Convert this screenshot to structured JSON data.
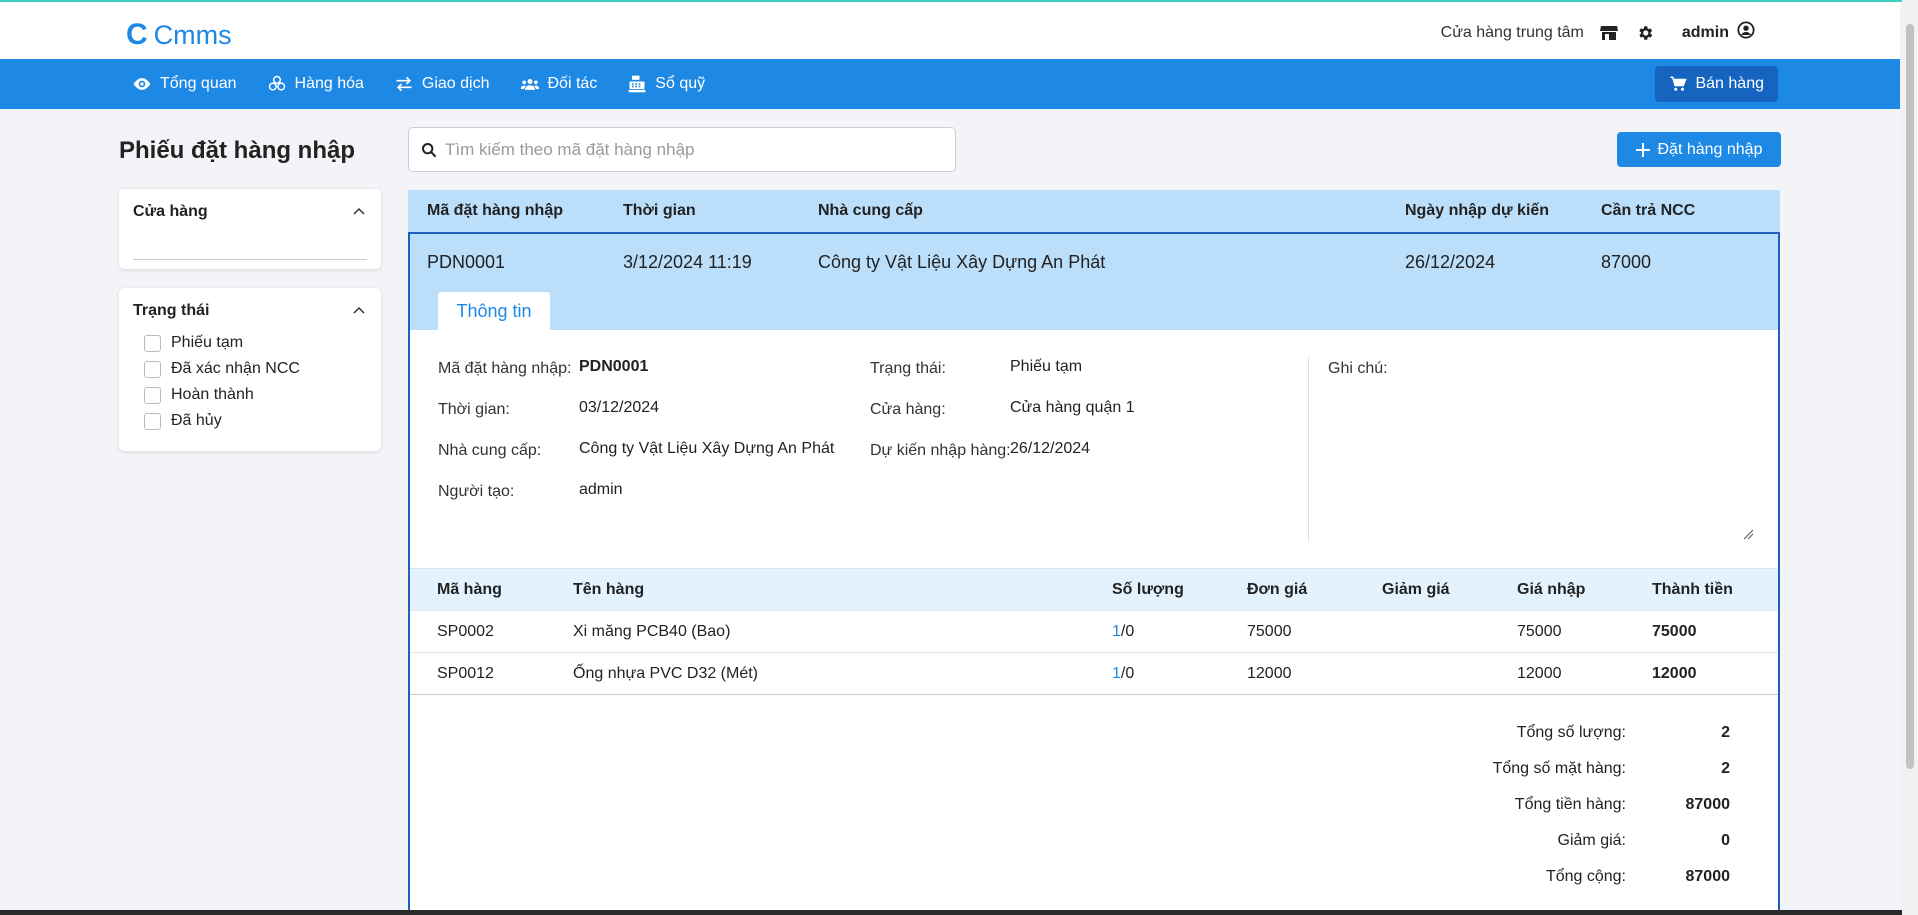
{
  "app": {
    "logo_text": "Cmms"
  },
  "header": {
    "store": "Cửa hàng trung tâm",
    "user": "admin"
  },
  "nav": {
    "items": [
      {
        "label": "Tổng quan",
        "icon": "eye-icon"
      },
      {
        "label": "Hàng hóa",
        "icon": "boxes-icon"
      },
      {
        "label": "Giao dịch",
        "icon": "exchange-icon"
      },
      {
        "label": "Đối tác",
        "icon": "users-icon"
      },
      {
        "label": "Sổ quỹ",
        "icon": "cash-register-icon"
      }
    ],
    "sell_button": "Bán hàng"
  },
  "page": {
    "title": "Phiếu đặt hàng nhập",
    "search_placeholder": "Tìm kiếm theo mã đặt hàng nhập",
    "add_button": "Đặt hàng nhập"
  },
  "filters": {
    "store_title": "Cửa hàng",
    "status_title": "Trạng thái",
    "status_options": [
      "Phiếu tạm",
      "Đã xác nhận NCC",
      "Hoàn thành",
      "Đã hủy"
    ]
  },
  "table": {
    "columns": [
      "Mã đặt hàng nhập",
      "Thời gian",
      "Nhà cung cấp",
      "Ngày nhập dự kiến",
      "Cần trả NCC"
    ],
    "row": {
      "code": "PDN0001",
      "time": "3/12/2024 11:19",
      "supplier": "Công ty Vật Liệu Xây Dựng An Phát",
      "expected_date": "26/12/2024",
      "payable": "87000"
    }
  },
  "detail": {
    "tab": "Thông tin",
    "labels": {
      "code": "Mã đặt hàng nhập:",
      "time": "Thời gian:",
      "supplier": "Nhà cung cấp:",
      "creator": "Người tạo:",
      "status": "Trạng thái:",
      "store": "Cửa hàng:",
      "expected": "Dự kiến nhập hàng:",
      "note": "Ghi chú:"
    },
    "values": {
      "code": "PDN0001",
      "time": "03/12/2024",
      "supplier": "Công ty Vật Liệu Xây Dựng An Phát",
      "creator": "admin",
      "status": "Phiếu tạm",
      "store": "Cửa hàng quận 1",
      "expected": "26/12/2024"
    }
  },
  "items": {
    "columns": [
      "Mã hàng",
      "Tên hàng",
      "Số lượng",
      "Đơn giá",
      "Giảm giá",
      "Giá nhập",
      "Thành tiền"
    ],
    "rows": [
      {
        "code": "SP0002",
        "name": "Xi măng PCB40 (Bao)",
        "qty_a": "1",
        "qty_b": "/0",
        "unit_price": "75000",
        "discount": "",
        "import_price": "75000",
        "total": "75000"
      },
      {
        "code": "SP0012",
        "name": "Ống nhựa PVC D32 (Mét)",
        "qty_a": "1",
        "qty_b": "/0",
        "unit_price": "12000",
        "discount": "",
        "import_price": "12000",
        "total": "12000"
      }
    ]
  },
  "summary": [
    {
      "label": "Tổng số lượng:",
      "value": "2"
    },
    {
      "label": "Tổng số mặt hàng:",
      "value": "2"
    },
    {
      "label": "Tổng tiền hàng:",
      "value": "87000"
    },
    {
      "label": "Giảm giá:",
      "value": "0"
    },
    {
      "label": "Tổng cộng:",
      "value": "87000"
    }
  ],
  "colors": {
    "primary": "#1e88e5",
    "dark_primary": "#1565c0",
    "row_highlight": "#bbdefb",
    "accent_line": "#3ecfc1"
  }
}
